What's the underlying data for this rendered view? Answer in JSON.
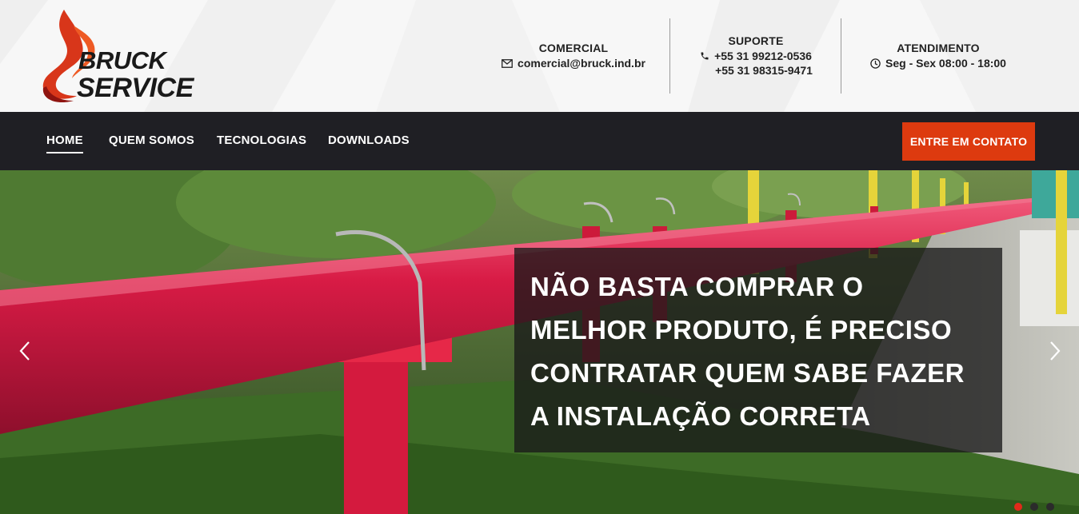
{
  "brand": {
    "logo_line1": "BRUCK",
    "logo_line2": "SERVICE",
    "flame_color": "#d8361a",
    "flame_dark": "#8f1410"
  },
  "header": {
    "commercial": {
      "title": "COMERCIAL",
      "email": "comercial@bruck.ind.br",
      "icon": "envelope-icon"
    },
    "support": {
      "title": "SUPORTE",
      "phone1": "+55 31 99212-0536",
      "phone2": "+55 31 98315-9471",
      "icon": "phone-icon"
    },
    "hours": {
      "title": "ATENDIMENTO",
      "text": "Seg - Sex 08:00 - 18:00",
      "icon": "clock-icon"
    }
  },
  "nav": {
    "items": [
      {
        "label": "HOME",
        "active": true
      },
      {
        "label": "QUEM SOMOS",
        "active": false
      },
      {
        "label": "TECNOLOGIAS",
        "active": false
      },
      {
        "label": "DOWNLOADS",
        "active": false
      }
    ],
    "cta_label": "ENTRE EM CONTATO",
    "cta_color": "#dd3a0f",
    "bg_color": "#1f1f24"
  },
  "hero": {
    "caption": "NÃO BASTA COMPRAR O\nMELHOR PRODUTO, É PRECISO\nCONTRATAR QUEM SABE FAZER\nA INSTALAÇÃO CORRETA",
    "prev_icon": "chevron-left-icon",
    "next_icon": "chevron-right-icon",
    "slides_total": 3,
    "active_slide": 1,
    "pipe_color": "#d81b45"
  }
}
